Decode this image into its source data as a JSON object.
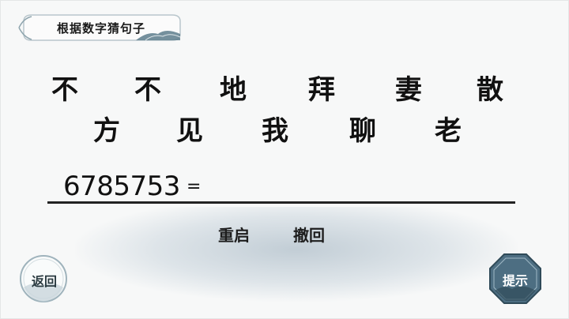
{
  "title": "根据数字猜句子",
  "characters": {
    "row1": [
      "不",
      "不",
      "地",
      "拜",
      "妻",
      "散"
    ],
    "row2": [
      "方",
      "见",
      "我",
      "聊",
      "老"
    ]
  },
  "equation": {
    "number": "6785753",
    "sign": "="
  },
  "actions": {
    "restart": "重启",
    "undo": "撤回"
  },
  "buttons": {
    "back": "返回",
    "hint": "提示"
  },
  "colors": {
    "background": "#f7f8f8",
    "hint_button": "#4d6e82",
    "mist": "#a9bccb"
  }
}
